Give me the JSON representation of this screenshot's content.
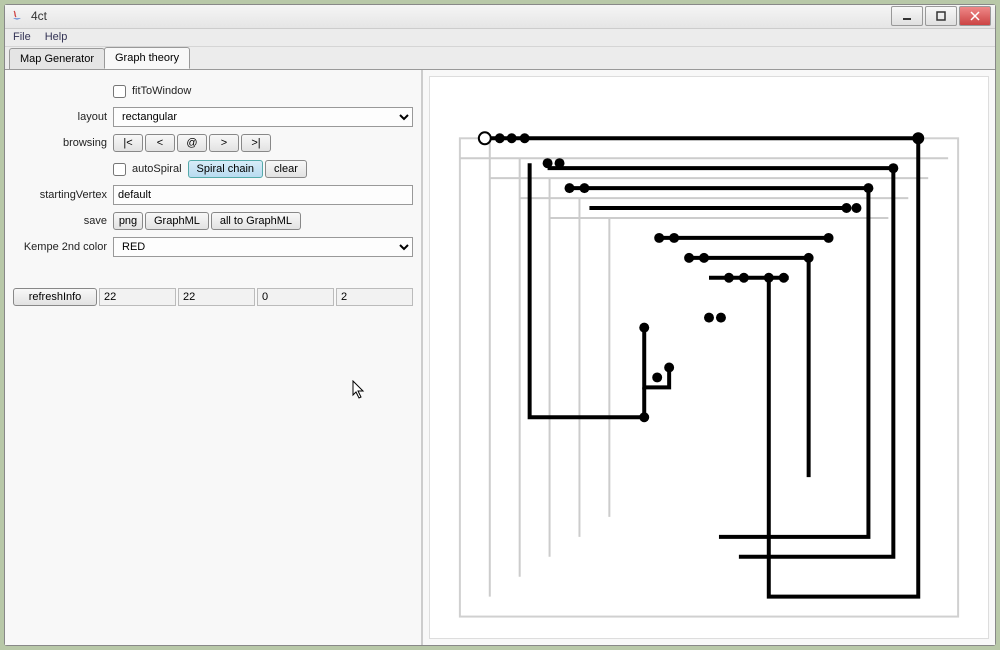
{
  "window": {
    "title": "4ct"
  },
  "menu": {
    "file": "File",
    "help": "Help"
  },
  "tabs": {
    "map_generator": "Map Generator",
    "graph_theory": "Graph theory"
  },
  "labels": {
    "layout": "layout",
    "browsing": "browsing",
    "starting_vertex": "startingVertex",
    "save": "save",
    "kempe_2nd_color": "Kempe 2nd color"
  },
  "checkboxes": {
    "fit_to_window": "fitToWindow",
    "auto_spiral": "autoSpiral"
  },
  "dropdowns": {
    "layout_value": "rectangular",
    "kempe_value": "RED"
  },
  "buttons": {
    "first": "|<",
    "prev": "<",
    "at": "@",
    "next": ">",
    "last": ">|",
    "spiral_chain": "Spiral chain",
    "clear": "clear",
    "png": "png",
    "graphml": "GraphML",
    "all_to_graphml": "all to GraphML",
    "refresh_info": "refreshInfo"
  },
  "inputs": {
    "starting_vertex_value": "default"
  },
  "info": {
    "v1": "22",
    "v2": "22",
    "v3": "0",
    "v4": "2"
  }
}
